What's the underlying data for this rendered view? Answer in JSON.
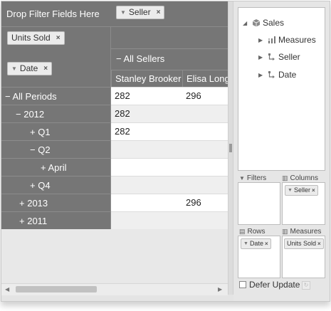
{
  "grid": {
    "drop_filter_label": "Drop Filter Fields Here",
    "units_sold_chip": "Units Sold",
    "seller_chip": "Seller",
    "date_chip": "Date",
    "all_sellers_label": "All Sellers",
    "sellers": [
      "Stanley Brooker",
      "Elisa Longb"
    ],
    "rows": [
      {
        "toggle": "−",
        "label": "All Periods",
        "values": [
          "282",
          "296"
        ]
      },
      {
        "toggle": "−",
        "label": "2012",
        "values": [
          "282",
          ""
        ]
      },
      {
        "toggle": "+",
        "label": "Q1",
        "values": [
          "282",
          ""
        ]
      },
      {
        "toggle": "−",
        "label": "Q2",
        "values": [
          "",
          ""
        ]
      },
      {
        "toggle": "+",
        "label": "April",
        "values": [
          "",
          ""
        ]
      },
      {
        "toggle": "+",
        "label": "Q4",
        "values": [
          "",
          ""
        ]
      },
      {
        "toggle": "+",
        "label": "2013",
        "values": [
          "",
          "296"
        ]
      },
      {
        "toggle": "+",
        "label": "2011",
        "values": [
          "",
          ""
        ]
      }
    ],
    "remove_glyph": "×",
    "funnel_glyph": "▼"
  },
  "field_list": {
    "cube": "Sales",
    "items": [
      "Measures",
      "Seller",
      "Date"
    ],
    "filters_label": "Filters",
    "columns_label": "Columns",
    "rows_label": "Rows",
    "measures_label": "Measures",
    "columns_chip": "Seller",
    "rows_chip": "Date",
    "measures_chip": "Units Sold",
    "defer_update_label": "Defer Update"
  },
  "icons": {
    "cube": "cube-icon",
    "measures": "measures-icon",
    "dimension": "hierarchy-icon",
    "filter": "funnel-icon",
    "columns": "columns-icon",
    "rows": "rows-icon",
    "refresh": "refresh-icon"
  },
  "colors": {
    "header_gray": "#767676",
    "row_white": "#ffffff",
    "row_alt": "#efefef"
  }
}
